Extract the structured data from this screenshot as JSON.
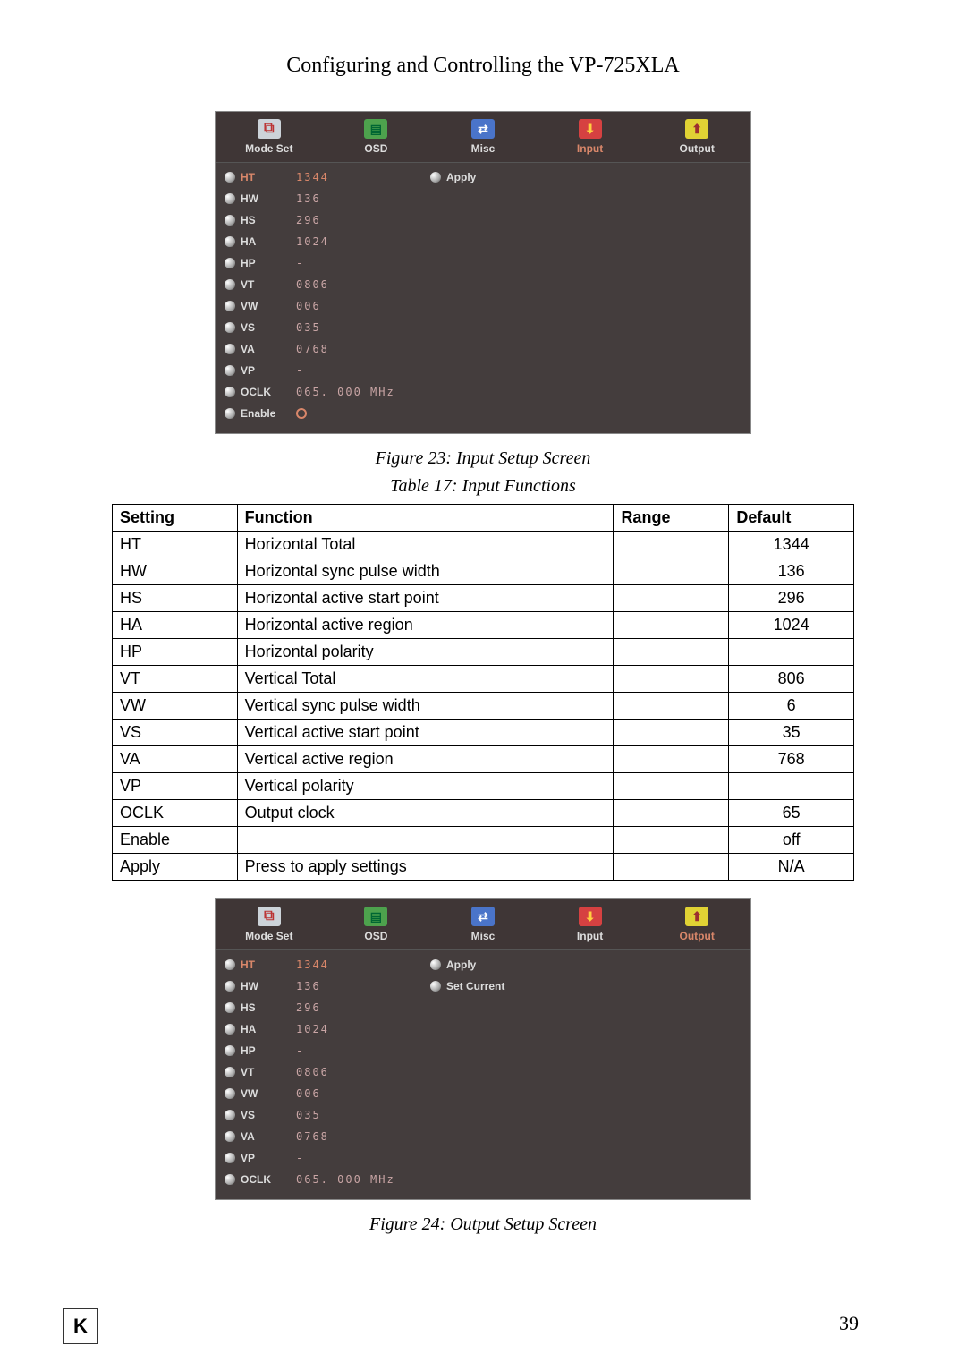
{
  "header": {
    "title": "Configuring and Controlling the VP-725XLA"
  },
  "tabs": [
    "Mode Set",
    "OSD",
    "Misc",
    "Input",
    "Output"
  ],
  "osd1": {
    "active_tab": "Input",
    "rows": [
      {
        "label": "HT",
        "value": "1344",
        "active": true
      },
      {
        "label": "HW",
        "value": "136"
      },
      {
        "label": "HS",
        "value": "296"
      },
      {
        "label": "HA",
        "value": "1024"
      },
      {
        "label": "HP",
        "value": "-"
      },
      {
        "label": "VT",
        "value": "0806"
      },
      {
        "label": "VW",
        "value": "006"
      },
      {
        "label": "VS",
        "value": "035"
      },
      {
        "label": "VA",
        "value": "0768"
      },
      {
        "label": "VP",
        "value": "-"
      },
      {
        "label": "OCLK",
        "value": "065. 000 MHz"
      },
      {
        "label": "Enable",
        "value": "__circle__"
      }
    ],
    "right_items": [
      "Apply"
    ]
  },
  "caption1": "Figure 23: Input Setup Screen",
  "caption2": "Table 17: Input Functions",
  "table": {
    "headers": [
      "Setting",
      "Function",
      "Range",
      "Default"
    ],
    "rows": [
      [
        "HT",
        "Horizontal Total",
        "",
        "1344"
      ],
      [
        "HW",
        "Horizontal sync pulse width",
        "",
        "136"
      ],
      [
        "HS",
        "Horizontal active start point",
        "",
        "296"
      ],
      [
        "HA",
        "Horizontal active region",
        "",
        "1024"
      ],
      [
        "HP",
        "Horizontal polarity",
        "",
        ""
      ],
      [
        "VT",
        "Vertical Total",
        "",
        "806"
      ],
      [
        "VW",
        "Vertical sync pulse width",
        "",
        "6"
      ],
      [
        "VS",
        "Vertical active start point",
        "",
        "35"
      ],
      [
        "VA",
        "Vertical active region",
        "",
        "768"
      ],
      [
        "VP",
        "Vertical polarity",
        "",
        ""
      ],
      [
        "OCLK",
        "Output clock",
        "",
        "65"
      ],
      [
        "Enable",
        "",
        "",
        "off"
      ],
      [
        "Apply",
        "Press to apply settings",
        "",
        "N/A"
      ]
    ]
  },
  "osd2": {
    "active_tab": "Output",
    "rows": [
      {
        "label": "HT",
        "value": "1344",
        "active": true
      },
      {
        "label": "HW",
        "value": "136"
      },
      {
        "label": "HS",
        "value": "296"
      },
      {
        "label": "HA",
        "value": "1024"
      },
      {
        "label": "HP",
        "value": "-"
      },
      {
        "label": "VT",
        "value": "0806"
      },
      {
        "label": "VW",
        "value": "006"
      },
      {
        "label": "VS",
        "value": "035"
      },
      {
        "label": "VA",
        "value": "0768"
      },
      {
        "label": "VP",
        "value": "-"
      },
      {
        "label": "OCLK",
        "value": "065. 000 MHz"
      }
    ],
    "right_items": [
      "Apply",
      "Set Current"
    ]
  },
  "caption3": "Figure 24: Output Setup Screen",
  "page_number": "39",
  "logo": "K"
}
